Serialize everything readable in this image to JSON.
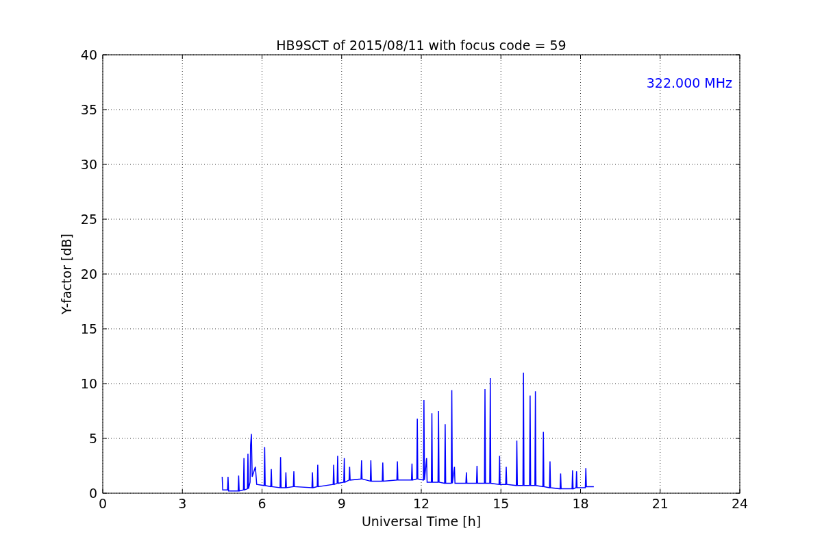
{
  "chart_data": {
    "type": "line",
    "title": "HB9SCT of 2015/08/11 with focus code = 59",
    "xlabel": "Universal Time [h]",
    "ylabel": "Y-factor [dB]",
    "xlim": [
      0,
      24
    ],
    "ylim": [
      0,
      40
    ],
    "xticks": [
      0,
      3,
      6,
      9,
      12,
      15,
      18,
      21,
      24
    ],
    "yticks": [
      0,
      5,
      10,
      15,
      20,
      25,
      30,
      35,
      40
    ],
    "grid": true,
    "annotations": [
      {
        "text": "322.000 MHz"
      }
    ],
    "x": [
      4.5,
      4.52,
      4.7,
      4.72,
      4.74,
      5.1,
      5.12,
      5.14,
      5.3,
      5.32,
      5.34,
      5.45,
      5.47,
      5.49,
      5.55,
      5.57,
      5.6,
      5.63,
      5.75,
      5.8,
      6.08,
      6.1,
      6.12,
      6.33,
      6.35,
      6.37,
      6.68,
      6.7,
      6.72,
      6.88,
      6.9,
      6.92,
      7.18,
      7.2,
      7.22,
      7.88,
      7.9,
      7.92,
      8.08,
      8.1,
      8.12,
      8.68,
      8.7,
      8.72,
      8.83,
      8.85,
      8.87,
      9.08,
      9.1,
      9.12,
      9.28,
      9.3,
      9.32,
      9.73,
      9.75,
      9.77,
      10.08,
      10.1,
      10.12,
      10.53,
      10.55,
      10.57,
      11.08,
      11.1,
      11.12,
      11.63,
      11.65,
      11.67,
      11.83,
      11.85,
      11.87,
      12.08,
      12.1,
      12.12,
      12.2,
      12.22,
      12.38,
      12.4,
      12.42,
      12.63,
      12.65,
      12.67,
      12.88,
      12.9,
      12.92,
      13.13,
      13.15,
      13.17,
      13.25,
      13.27,
      13.68,
      13.7,
      13.72,
      14.08,
      14.1,
      14.12,
      14.38,
      14.4,
      14.42,
      14.58,
      14.6,
      14.62,
      14.93,
      14.95,
      14.97,
      15.18,
      15.2,
      15.22,
      15.58,
      15.6,
      15.62,
      15.83,
      15.85,
      15.87,
      16.08,
      16.1,
      16.12,
      16.28,
      16.3,
      16.32,
      16.58,
      16.6,
      16.62,
      16.83,
      16.85,
      16.87,
      17.23,
      17.25,
      17.27,
      17.68,
      17.7,
      17.72,
      17.83,
      17.85,
      17.87,
      18.18,
      18.2,
      18.22,
      18.5
    ],
    "series": [
      {
        "color": "#0000ff",
        "values": [
          1.5,
          0.3,
          0.3,
          1.5,
          0.2,
          0.2,
          1.6,
          0.2,
          0.3,
          3.2,
          0.3,
          0.4,
          3.6,
          0.4,
          1.0,
          4.4,
          5.4,
          1.5,
          2.4,
          0.8,
          0.7,
          4.2,
          0.7,
          0.6,
          2.2,
          0.6,
          0.5,
          3.3,
          0.5,
          0.5,
          1.9,
          0.5,
          0.6,
          2.0,
          0.6,
          0.5,
          1.9,
          0.5,
          0.6,
          2.6,
          0.6,
          0.8,
          2.6,
          0.8,
          0.9,
          3.4,
          0.9,
          1.0,
          3.2,
          1.0,
          1.2,
          2.4,
          1.2,
          1.3,
          3.0,
          1.3,
          1.1,
          3.0,
          1.1,
          1.1,
          2.8,
          1.1,
          1.2,
          2.9,
          1.2,
          1.2,
          2.7,
          1.2,
          1.3,
          6.8,
          1.3,
          1.2,
          8.5,
          1.2,
          3.2,
          1.0,
          1.0,
          7.3,
          1.0,
          1.0,
          7.5,
          1.0,
          0.9,
          6.3,
          0.9,
          0.9,
          9.4,
          0.9,
          2.4,
          0.9,
          0.9,
          1.9,
          0.9,
          0.9,
          2.5,
          0.9,
          0.9,
          9.5,
          0.9,
          0.9,
          10.5,
          0.9,
          0.8,
          3.4,
          0.8,
          0.8,
          2.4,
          0.8,
          0.7,
          4.8,
          0.7,
          0.7,
          11.0,
          0.7,
          0.7,
          8.9,
          0.7,
          0.7,
          9.3,
          0.7,
          0.6,
          5.6,
          0.6,
          0.5,
          2.9,
          0.5,
          0.4,
          1.8,
          0.4,
          0.4,
          2.1,
          0.4,
          0.5,
          2.0,
          0.5,
          0.5,
          2.3,
          0.6,
          0.6
        ]
      }
    ]
  }
}
